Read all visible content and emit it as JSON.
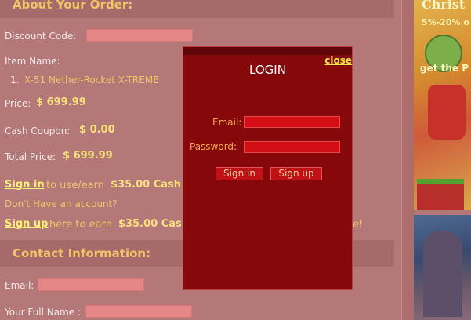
{
  "order": {
    "title": "About Your Order:",
    "discount_label": "Discount Code:",
    "item_label": "Item Name:",
    "item_index": "1.",
    "item_name": "X-51 Nether-Rocket X-TREME",
    "price_label": "Price:",
    "price_value": "$ 699.99",
    "coupon_label": "Cash Coupon:",
    "coupon_value": "$ 0.00",
    "total_label": "Total Price:",
    "total_value": "$ 699.99",
    "signin_link": "Sign in",
    "signin_text": "to use/earn",
    "signin_amount": "$35.00 Cash",
    "no_account": "Don't Have an account?",
    "signup_link": "Sign up",
    "signup_text": "here to earn",
    "signup_amount": "$35.00 Cas",
    "signup_tail": "e!"
  },
  "contact": {
    "title": "Contact Information:",
    "email_label": "Email:",
    "fullname_label": "Your Full Name :"
  },
  "promo": {
    "top_text": "5%-20% o",
    "mid_text": "get the P",
    "brand_text": "Christ"
  },
  "login": {
    "title": "LOGIN",
    "close": "close",
    "email_label": "Email:",
    "password_label": "Password:",
    "signin_button": "Sign in",
    "signup_button": "Sign up"
  },
  "colors": {
    "page_bg": "#b37877",
    "modal_bg": "#87080a",
    "accent_gold": "#f3c36a",
    "link_yellow": "#fff17a"
  }
}
